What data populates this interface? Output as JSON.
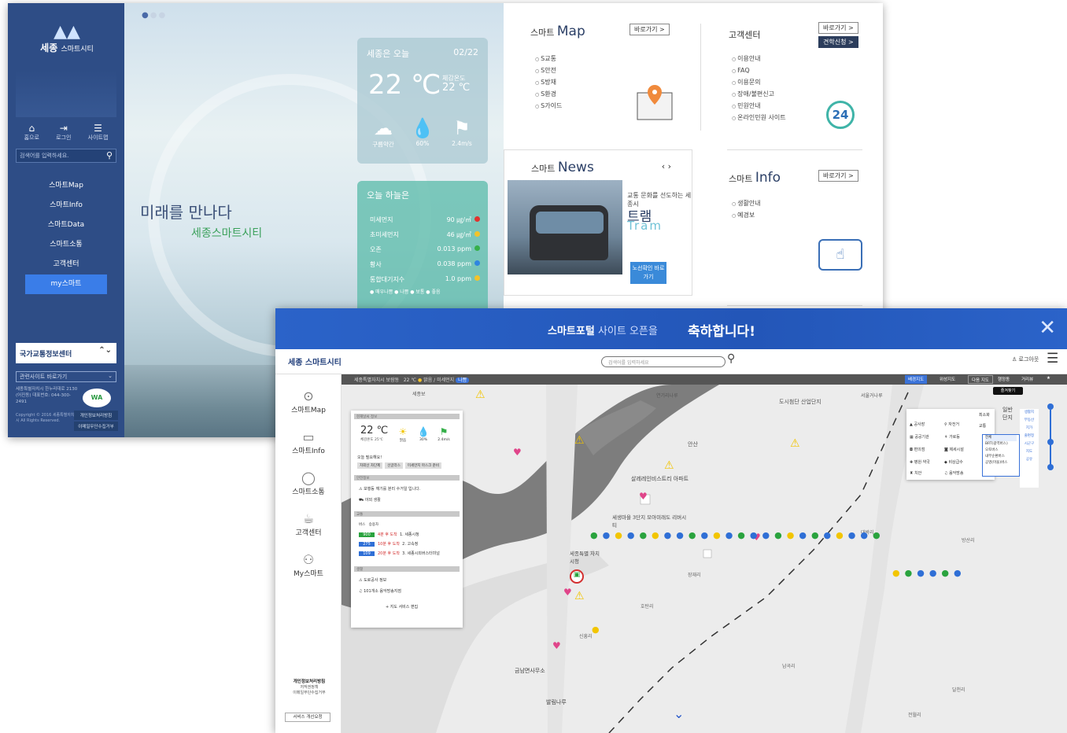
{
  "portal": {
    "logo": {
      "main": "세종",
      "sub": "스마트시티"
    },
    "quick_links": [
      {
        "icon": "home-icon",
        "label": "홈으로"
      },
      {
        "icon": "login-icon",
        "label": "로그인"
      },
      {
        "icon": "sitemap-icon",
        "label": "사이트맵"
      }
    ],
    "search_placeholder": "검색어를 입력하세요.",
    "menu": [
      "스마트Map",
      "스마트Info",
      "스마트Data",
      "스마트소통",
      "고객센터",
      "my스마트"
    ],
    "its_label": "국가교통정보센터",
    "family_site": "관련사이트 바로가기",
    "address": "세종특별자치시 한누리대로 2130 (어진동) 대표번호: 044-300-2491",
    "wa_label": "WA",
    "copyright": "Copyright © 2016 세종특별자치시 All Rights Reserved.",
    "policy_links": [
      "개인정보처리방침",
      "이메일무단수집거부"
    ],
    "hero_title": "미래를 만나다",
    "hero_subtitle": "세종스마트시티",
    "weather": {
      "title": "세종은 오늘",
      "date": "02/22",
      "temp": "22 ℃",
      "feels_label": "체감온도",
      "feels": "22 ℃",
      "items": [
        {
          "icon": "cloud-icon",
          "label": "구름약간"
        },
        {
          "icon": "drop-icon",
          "label": "60%"
        },
        {
          "icon": "wind-icon",
          "label": "2.4m/s"
        }
      ]
    },
    "air": {
      "title": "오늘 하늘은",
      "rows": [
        {
          "name": "미세먼지",
          "value": "90 ㎍/㎥",
          "color": "#e0332e"
        },
        {
          "name": "초미세먼지",
          "value": "46 ㎍/㎥",
          "color": "#f3c32a"
        },
        {
          "name": "오존",
          "value": "0.013 ppm",
          "color": "#36b04a"
        },
        {
          "name": "황사",
          "value": "0.038 ppm",
          "color": "#2f86e0"
        },
        {
          "name": "통합대기지수",
          "value": "1.0 ppm",
          "color": "#f3c32a"
        }
      ],
      "legend": "● 매우나쁨  ● 나쁨  ● 보통  ● 좋음"
    },
    "smart_map": {
      "pre": "스마트",
      "title": "Map",
      "go": "바로가기 >",
      "items": [
        "S교통",
        "S안전",
        "S방재",
        "S환경",
        "S가이드"
      ]
    },
    "customer": {
      "title": "고객센터",
      "go": "바로가기 >",
      "go2": "견학신청 >",
      "items": [
        "이용안내",
        "FAQ",
        "이용문의",
        "장애/불편신고",
        "민원안내",
        "온라인민원 사이트"
      ],
      "badge": "24"
    },
    "smart_news": {
      "pre": "스마트",
      "title": "News",
      "arrows": "‹ ›",
      "text": "교통 문화를 선도하는 세종시",
      "big": "트램",
      "en": "Tram",
      "btn": "노선확인 바로가기"
    },
    "smart_info": {
      "pre": "스마트",
      "title": "Info",
      "go": "바로가기 >",
      "items": [
        "생활안내",
        "예경보"
      ]
    }
  },
  "map_page": {
    "banner": {
      "brand": "스마트포털",
      "rest": "사이트 오픈을",
      "congrats": "축하합니다!",
      "close": "✕"
    },
    "logo": "세종 스마트시티",
    "search_placeholder": "검색어를 입력하세요",
    "login": "로그아웃",
    "nav": [
      {
        "icon": "map-pin-icon",
        "label": "스마트Map"
      },
      {
        "icon": "monitor-icon",
        "label": "스마트Info"
      },
      {
        "icon": "chat-icon",
        "label": "스마트소통"
      },
      {
        "icon": "cup-icon",
        "label": "고객센터"
      },
      {
        "icon": "people-icon",
        "label": "My스마트"
      }
    ],
    "footer_links": [
      "개인정보처리방침",
      "저작권정책",
      "이메일무단수집거부"
    ],
    "service_btn": "서비스 개선요청",
    "status_bar": {
      "location": "세종특별자치시 보람동",
      "temp": "22 ℃",
      "weather": "맑음",
      "dust": "미세먼지",
      "dust_level": "나쁨"
    },
    "map_tabs": [
      "배경지도",
      "위성지도",
      "다음 지도",
      "행정동",
      "거리뷰"
    ],
    "favorites": "즐겨찾기",
    "info_panel": {
      "weather_title": "현재날씨 정보",
      "temp": "22 ℃",
      "feels": "체감온도 25℃",
      "weather_items": [
        {
          "icon": "sun-icon",
          "label": "맑음"
        },
        {
          "icon": "drop-icon",
          "label": "30%"
        },
        {
          "icon": "wind-icon",
          "label": "2.4m/s"
        }
      ],
      "tip_title": "오늘 필요해요!",
      "chips": [
        "자외선 차단제",
        "선글라스",
        "미세먼지 마스크 준비"
      ],
      "alert_title": "안전정보",
      "alerts": [
        "보행등 깨기를 분리 수거일 입니다.",
        "야외 생활"
      ],
      "bus_title": "교통",
      "bus_tabs": [
        "버스",
        "승용차"
      ],
      "buses": [
        {
          "no": "900",
          "color": "#2aa33e",
          "eta": "4분 후 도착",
          "stop": "1. 세종시청"
        },
        {
          "no": "275",
          "color": "#2f6fd6",
          "eta": "10분 후 도착",
          "stop": "2. 고속정"
        },
        {
          "no": "109",
          "color": "#2f6fd6",
          "eta": "20분 후 도착",
          "stop": "3. 세종시외버스터미널"
        }
      ],
      "event_title": "생활",
      "events": [
        "도로공사 정보",
        "101개소 음악방송지점"
      ],
      "more": "+ 지도 서비스 편집"
    },
    "place_labels": [
      "도시첨단 산업단지",
      "연기리나루",
      "세종보",
      "서울거나루",
      "살레레인비스트리 아파트",
      "세생마을 3단지 모아미래도 리버시티",
      "세종특별 자치시청",
      "안산",
      "금남면사무소",
      "발림나루",
      "전월리",
      "대박리",
      "방산리",
      "장재리",
      "호탄리",
      "달천리",
      "남곡리",
      "일반 단지",
      "신흥리"
    ],
    "layer_panel": {
      "groups": [
        "공사장",
        "자전거",
        "공공기관",
        "가로등",
        "편의점",
        "제세시설",
        "병원·약국",
        "비상급수",
        "치안",
        "음악방송",
        "최소화",
        "교통",
        "버스"
      ],
      "sub": [
        "전체",
        "BRT(광역버스)",
        "오토버스",
        "내부순환버스",
        "공영(마을)버스"
      ]
    },
    "right_tools": [
      "생활지",
      "부동산",
      "지가",
      "줄편정",
      "시군구",
      "지도",
      "공유"
    ]
  }
}
